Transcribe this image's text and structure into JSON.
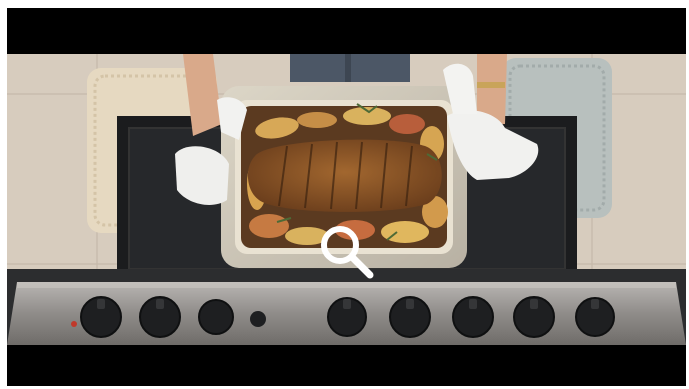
{
  "video": {
    "scene": "roast-in-baking-dish-over-stove"
  },
  "overlay": {
    "icon": "search-icon",
    "color": "#ffffff"
  },
  "colors": {
    "letterbox": "#000000",
    "tile": "#d9cfc2",
    "steel": "#9a9896"
  }
}
